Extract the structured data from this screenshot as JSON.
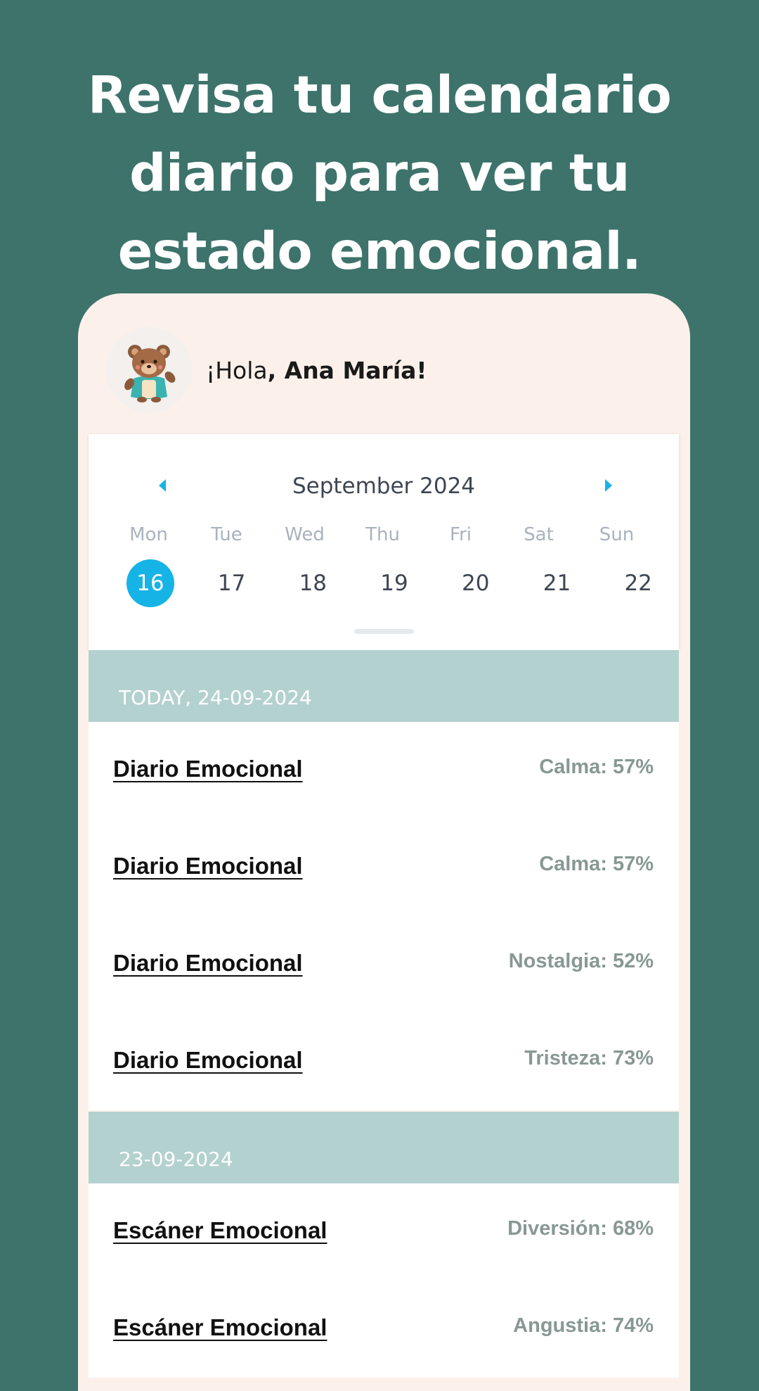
{
  "headline": {
    "line1": "Revisa tu calendario",
    "line2": "diario para ver tu",
    "line3": "estado emocional."
  },
  "greeting": {
    "prefix": "¡Hola",
    "name": ", Ana María!"
  },
  "calendar": {
    "month": "September 2024",
    "weekdays": [
      "Mon",
      "Tue",
      "Wed",
      "Thu",
      "Fri",
      "Sat",
      "Sun"
    ],
    "days": [
      "16",
      "17",
      "18",
      "19",
      "20",
      "21",
      "22"
    ],
    "selected_day": "16",
    "accent_color": "#16b3e6"
  },
  "sections": [
    {
      "header": "TODAY, 24-09-2024",
      "entries": [
        {
          "title": "Diario Emocional",
          "value": "Calma: 57%"
        },
        {
          "title": "Diario Emocional",
          "value": "Calma: 57%"
        },
        {
          "title": "Diario Emocional",
          "value": "Nostalgia: 52%"
        },
        {
          "title": "Diario Emocional",
          "value": "Tristeza: 73%"
        }
      ]
    },
    {
      "header": "23-09-2024",
      "entries": [
        {
          "title": "Escáner Emocional",
          "value": "Diversión: 68%"
        },
        {
          "title": "Escáner Emocional",
          "value": "Angustia: 74%"
        }
      ]
    }
  ],
  "icons": {
    "prev": "chevron-left-icon",
    "next": "chevron-right-icon",
    "avatar": "bear-mascot-avatar"
  },
  "colors": {
    "background": "#3d736b",
    "card": "#fcf1ea",
    "section_header": "#b3d1cf",
    "value_text": "#889894"
  }
}
